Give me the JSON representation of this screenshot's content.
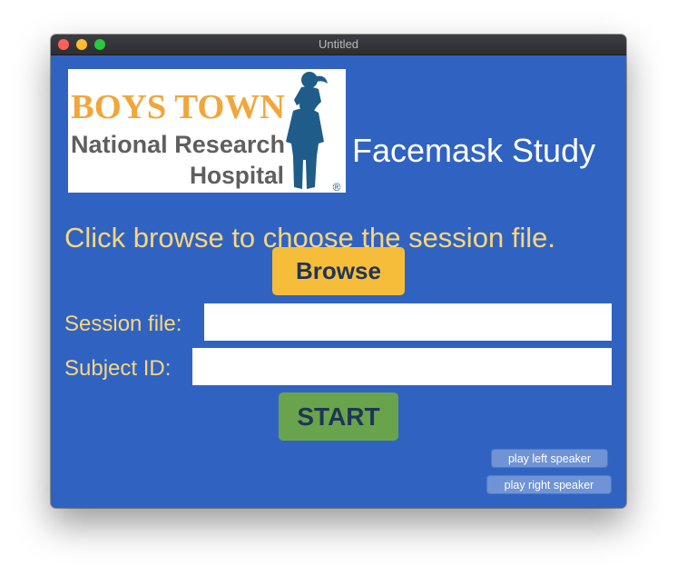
{
  "window": {
    "title": "Untitled"
  },
  "logo": {
    "line1": "BOYS TOWN",
    "line2": "National Research",
    "line3": "Hospital",
    "mark": "®"
  },
  "app": {
    "title": "Facemask Study",
    "instruction": "Click browse to choose the session file."
  },
  "buttons": {
    "browse": "Browse",
    "start": "START",
    "play_left": "play left speaker",
    "play_right": "play right speaker"
  },
  "fields": {
    "session_label": "Session file:",
    "session_value": "",
    "subject_label": "Subject ID:",
    "subject_value": ""
  },
  "colors": {
    "background": "#3063c1",
    "label_text": "#f9d67e",
    "browse_button": "#f6bd3b",
    "start_button": "#69a44d",
    "logo_orange": "#f2a63a",
    "logo_gray": "#5f5f60",
    "logo_figure": "#1f5c8a"
  }
}
